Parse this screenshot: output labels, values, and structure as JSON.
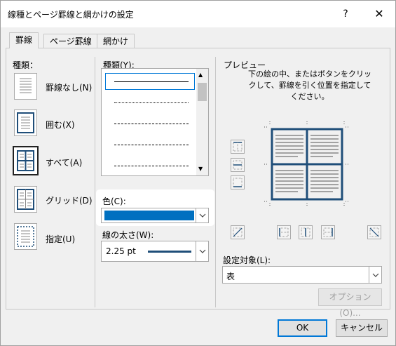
{
  "window": {
    "title": "線種とページ罫線と網かけの設定",
    "help_label": "?",
    "close_label": "✕"
  },
  "tabs": [
    {
      "label": "罫線",
      "active": true
    },
    {
      "label": "ページ罫線",
      "active": false
    },
    {
      "label": "網かけ",
      "active": false
    }
  ],
  "settings": {
    "label": "種類：",
    "items": [
      {
        "label": "罫線なし(N)",
        "icon": "no-border-icon",
        "selected": false
      },
      {
        "label": "囲む(X)",
        "icon": "box-border-icon",
        "selected": false
      },
      {
        "label": "すべて(A)",
        "icon": "all-borders-icon",
        "selected": true
      },
      {
        "label": "グリッド(D)",
        "icon": "grid-border-icon",
        "selected": false
      },
      {
        "label": "指定(U)",
        "icon": "custom-border-icon",
        "selected": false
      }
    ]
  },
  "style": {
    "label": "種類(Y):",
    "color_label": "色(C):",
    "color_value": "#0070c0",
    "width_label": "線の太さ(W):",
    "width_value": "2.25 pt"
  },
  "preview": {
    "label": "プレビュー",
    "instruction": "下の絵の中、またはボタンをクリックして、罫線を引く位置を指定してください。",
    "border_color": "#1f4e79"
  },
  "apply_to": {
    "label": "設定対象(L):",
    "value": "表"
  },
  "buttons": {
    "options": "オプション(O)...",
    "ok": "OK",
    "cancel": "キャンセル"
  }
}
